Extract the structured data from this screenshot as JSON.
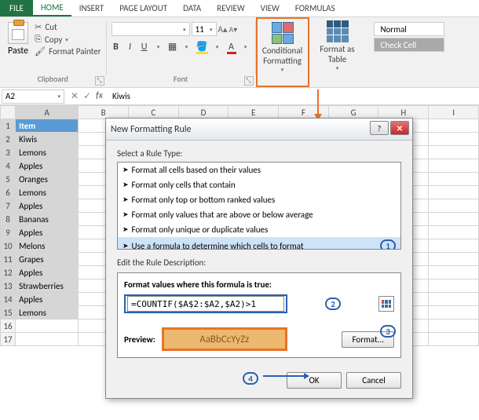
{
  "tabs": {
    "file": "FILE",
    "items": [
      "HOME",
      "INSERT",
      "PAGE LAYOUT",
      "DATA",
      "REVIEW",
      "VIEW",
      "FORMULAS"
    ],
    "active_index": 0
  },
  "ribbon": {
    "clipboard": {
      "paste": "Paste",
      "cut": "Cut",
      "copy": "Copy",
      "format_painter": "Format Painter",
      "group": "Clipboard"
    },
    "font": {
      "name": "",
      "size": "11",
      "group": "Font"
    },
    "cf": {
      "label": "Conditional Formatting"
    },
    "fat": {
      "label": "Format as Table"
    },
    "styles": {
      "normal": "Normal",
      "check": "Check Cell"
    }
  },
  "namebox": "A2",
  "formula_value": "Kiwis",
  "columns": [
    "A",
    "B",
    "C",
    "D",
    "E",
    "F",
    "G",
    "H",
    "I"
  ],
  "header_cell": "Item",
  "data": [
    "Kiwis",
    "Lemons",
    "Apples",
    "Oranges",
    "Lemons",
    "Apples",
    "Bananas",
    "Apples",
    "Melons",
    "Grapes",
    "Apples",
    "Strawberries",
    "Apples",
    "Lemons"
  ],
  "empty_rows": [
    16,
    17
  ],
  "dialog": {
    "title": "New Formatting Rule",
    "select_label": "Select a Rule Type:",
    "rules": [
      "Format all cells based on their values",
      "Format only cells that contain",
      "Format only top or bottom ranked values",
      "Format only values that are above or below average",
      "Format only unique or duplicate values",
      "Use a formula to determine which cells to format"
    ],
    "selected_rule_index": 5,
    "edit_label": "Edit the Rule Description:",
    "formula_label": "Format values where this formula is true:",
    "formula": "=COUNTIF($A$2:$A2,$A2)>1",
    "preview_label": "Preview:",
    "preview_text": "AaBbCcYyZz",
    "format_btn": "Format...",
    "ok": "OK",
    "cancel": "Cancel",
    "callouts": {
      "c1": "1",
      "c2": "2",
      "c3": "3",
      "c4": "4"
    }
  }
}
